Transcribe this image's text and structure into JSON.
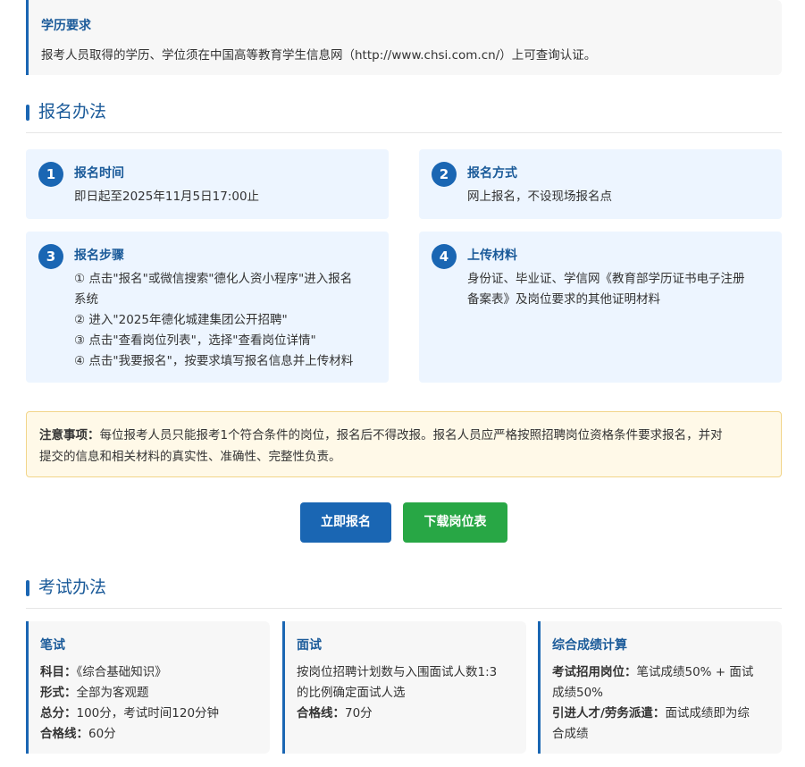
{
  "education": {
    "title": "学历要求",
    "text": "报考人员取得的学历、学位须在中国高等教育学生信息网（http://www.chsi.com.cn/）上可查询认证。"
  },
  "registration": {
    "heading": "报名办法",
    "steps": [
      {
        "num": "1",
        "title": "报名时间",
        "lines": [
          "即日起至2025年11月5日17:00止"
        ]
      },
      {
        "num": "2",
        "title": "报名方式",
        "lines": [
          "网上报名，不设现场报名点"
        ]
      },
      {
        "num": "3",
        "title": "报名步骤",
        "lines": [
          "① 点击\"报名\"或微信搜索\"德化人资小程序\"进入报名",
          "系统",
          "② 进入\"2025年德化城建集团公开招聘\"",
          "③ 点击\"查看岗位列表\"，选择\"查看岗位详情\"",
          "④ 点击\"我要报名\"，按要求填写报名信息并上传材料"
        ]
      },
      {
        "num": "4",
        "title": "上传材料",
        "lines": [
          "身份证、毕业证、学信网《教育部学历证书电子注册",
          "备案表》及岗位要求的其他证明材料"
        ]
      }
    ]
  },
  "notice": {
    "label": "注意事项：",
    "line1": "每位报考人员只能报考1个符合条件的岗位，报名后不得改报。报名人员应严格按照招聘岗位资格条件要求报名，并对",
    "line2": "提交的信息和相关材料的真实性、准确性、完整性负责。"
  },
  "buttons": {
    "apply": "立即报名",
    "download": "下载岗位表"
  },
  "exam": {
    "heading": "考试办法",
    "written": {
      "title": "笔试",
      "subject_label": "科目：",
      "subject": "《综合基础知识》",
      "form_label": "形式：",
      "form": "全部为客观题",
      "total_label": "总分：",
      "total": "100分，考试时间120分钟",
      "pass_label": "合格线：",
      "pass": "60分"
    },
    "interview": {
      "title": "面试",
      "line1": "按岗位招聘计划数与入围面试人数1:3",
      "line2": "的比例确定面试人选",
      "pass_label": "合格线：",
      "pass": "70分"
    },
    "overall": {
      "title": "综合成绩计算",
      "posts_label": "考试招用岗位：",
      "posts_line1": "笔试成绩50% + 面试",
      "posts_line2": "成绩50%",
      "talent_label": "引进人才/劳务派遣：",
      "talent_line1": "面试成绩即为综",
      "talent_line2": "合成绩"
    }
  }
}
